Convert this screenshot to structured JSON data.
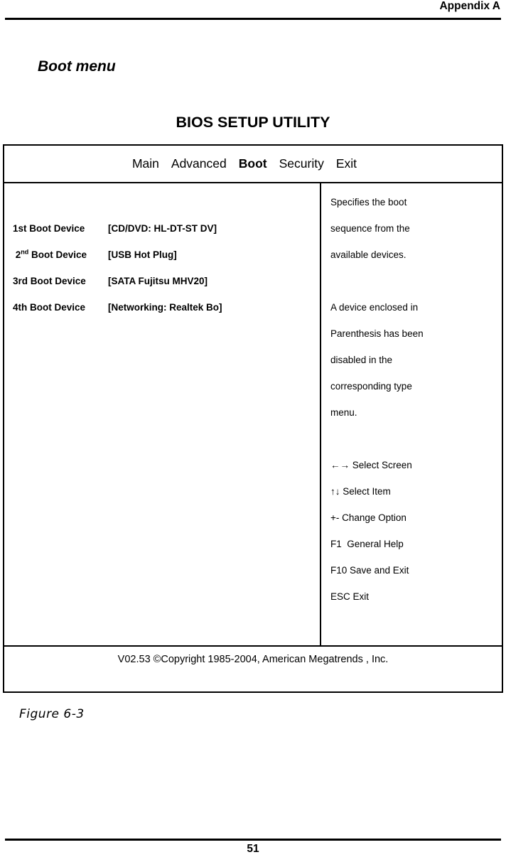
{
  "header": {
    "appendix_label": "Appendix A"
  },
  "section": {
    "title": "Boot menu"
  },
  "bios": {
    "title": "BIOS SETUP UTILITY",
    "menu": [
      {
        "label": "Main",
        "active": false
      },
      {
        "label": "Advanced",
        "active": false
      },
      {
        "label": "Boot",
        "active": true
      },
      {
        "label": "Security",
        "active": false
      },
      {
        "label": "Exit",
        "active": false
      }
    ],
    "boot_devices": [
      {
        "label": "1st Boot Device",
        "sup": "",
        "value": "[CD/DVD: HL-DT-ST DV]"
      },
      {
        "label": "2",
        "sup": "nd",
        "label_tail": " Boot Device",
        "value": "[USB Hot Plug]"
      },
      {
        "label": "3rd Boot Device",
        "sup": "",
        "value": "[SATA Fujitsu MHV20]"
      },
      {
        "label": "4th Boot Device",
        "sup": "",
        "value": "[Networking: Realtek Bo]"
      }
    ],
    "help_lines": [
      "Specifies the boot",
      "sequence from the",
      "available devices.",
      "",
      "A device enclosed in",
      "Parenthesis has been",
      "disabled in the",
      "corresponding type",
      "menu.",
      "",
      "←→ Select Screen",
      "↑↓ Select Item",
      "+- Change Option",
      "F1  General Help",
      "F10 Save and Exit",
      "ESC Exit"
    ],
    "copyright": "V02.53 ©Copyright 1985-2004, American Megatrends , Inc."
  },
  "figure": {
    "caption": "Figure 6-3"
  },
  "footer": {
    "page_number": "51"
  }
}
